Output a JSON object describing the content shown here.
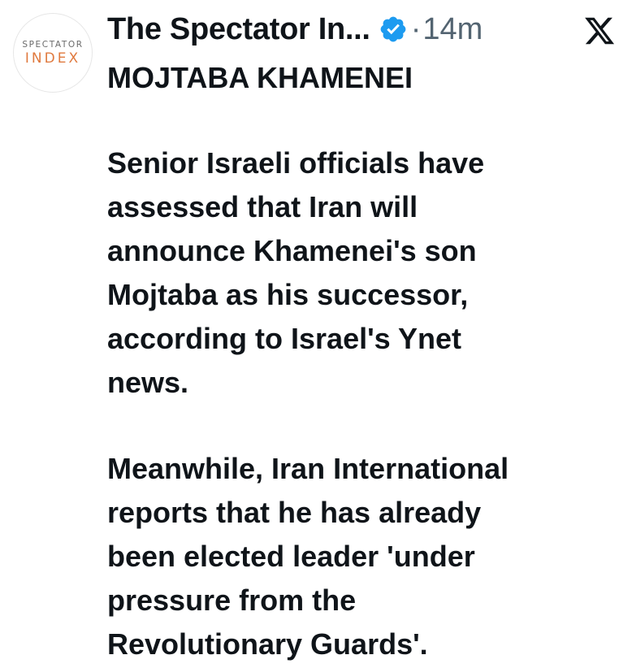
{
  "post": {
    "avatar": {
      "line1": "SPECTATOR",
      "line2": "INDEX"
    },
    "display_name": "The Spectator In...",
    "verified_icon": "verified-badge-icon",
    "separator": "·",
    "timestamp": "14m",
    "platform_icon": "x-logo-icon",
    "headline": "MOJTABA KHAMENEI",
    "paragraph1": [
      "Senior Israeli officials have",
      "assessed that Iran will",
      "announce Khamenei's son",
      "Mojtaba as his successor,",
      "according to Israel's Ynet",
      "news."
    ],
    "paragraph2": [
      "Meanwhile, Iran International",
      "reports that he has already",
      "been elected leader 'under",
      "pressure from the",
      "Revolutionary Guards'."
    ]
  },
  "colors": {
    "text": "#0f1419",
    "secondary": "#536471",
    "verified": "#1d9bf0",
    "avatar_top": "#6b6b6b",
    "avatar_bottom": "#e07a3f"
  }
}
